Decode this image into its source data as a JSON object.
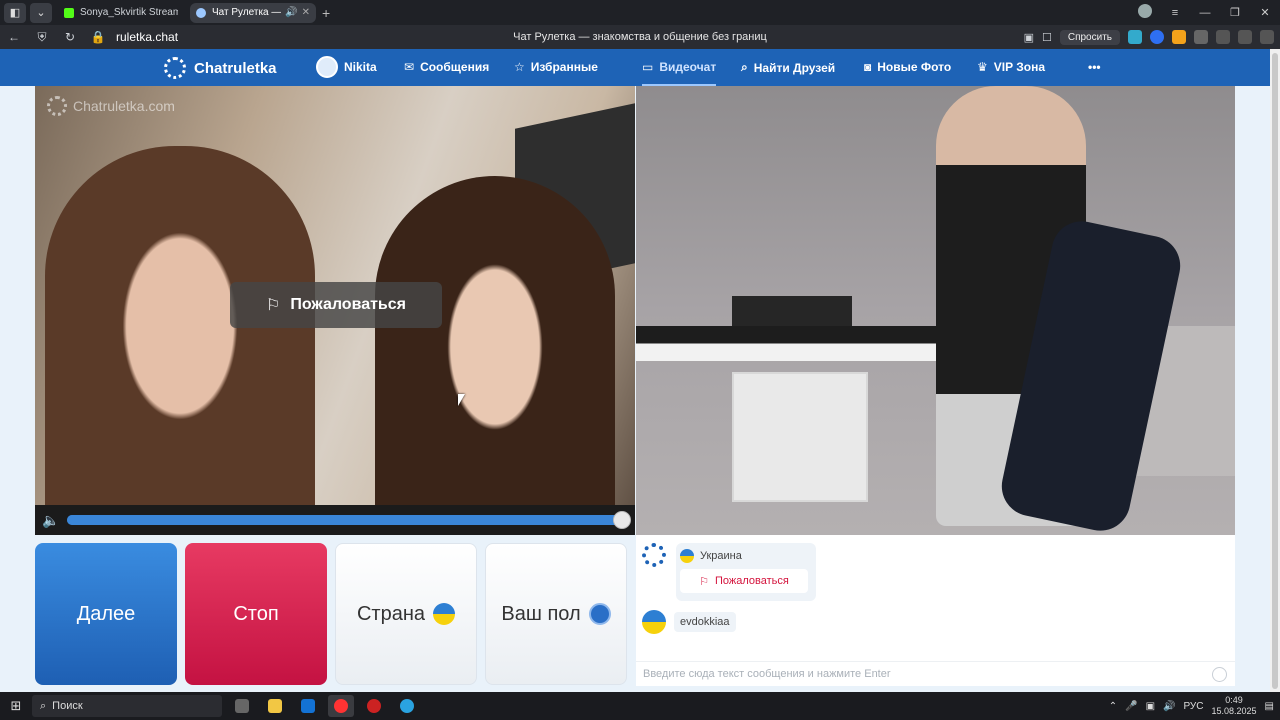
{
  "browser": {
    "tabs": [
      {
        "label": "Sonya_Skvirtik Stream - Ki",
        "active": false
      },
      {
        "label": "Чат Рулетка — знак",
        "active": true
      }
    ],
    "url": "ruletka.chat",
    "page_title": "Чат Рулетка — знакомства и общение без границ",
    "ask_label": "Спросить"
  },
  "header": {
    "logo": "Chatruletka",
    "nav": {
      "user": "Nikita",
      "messages": "Сообщения",
      "favorites": "Избранные",
      "videochat": "Видеочат",
      "find_friends": "Найти Друзей",
      "new_photos": "Новые Фото",
      "vip": "VIP Зона",
      "more": "•••"
    }
  },
  "left_video": {
    "watermark": "Chatruletka.com",
    "report_label": "Пожаловаться",
    "volume_percent": 100
  },
  "controls": {
    "next": "Далее",
    "stop": "Стоп",
    "country": "Страна",
    "gender": "Ваш пол"
  },
  "chat": {
    "partner_country": "Украина",
    "report_label": "Пожаловаться",
    "username": "evdokkiaa",
    "input_placeholder": "Введите сюда текст сообщения и нажмите Enter"
  },
  "taskbar": {
    "search": "Поиск",
    "lang": "РУС",
    "time": "0:49",
    "date": "15.08.2025"
  },
  "colors": {
    "brand_blue": "#1e63b6",
    "next_button": "#2a75cc",
    "stop_button": "#d61f4d",
    "report_red": "#d4143d"
  }
}
